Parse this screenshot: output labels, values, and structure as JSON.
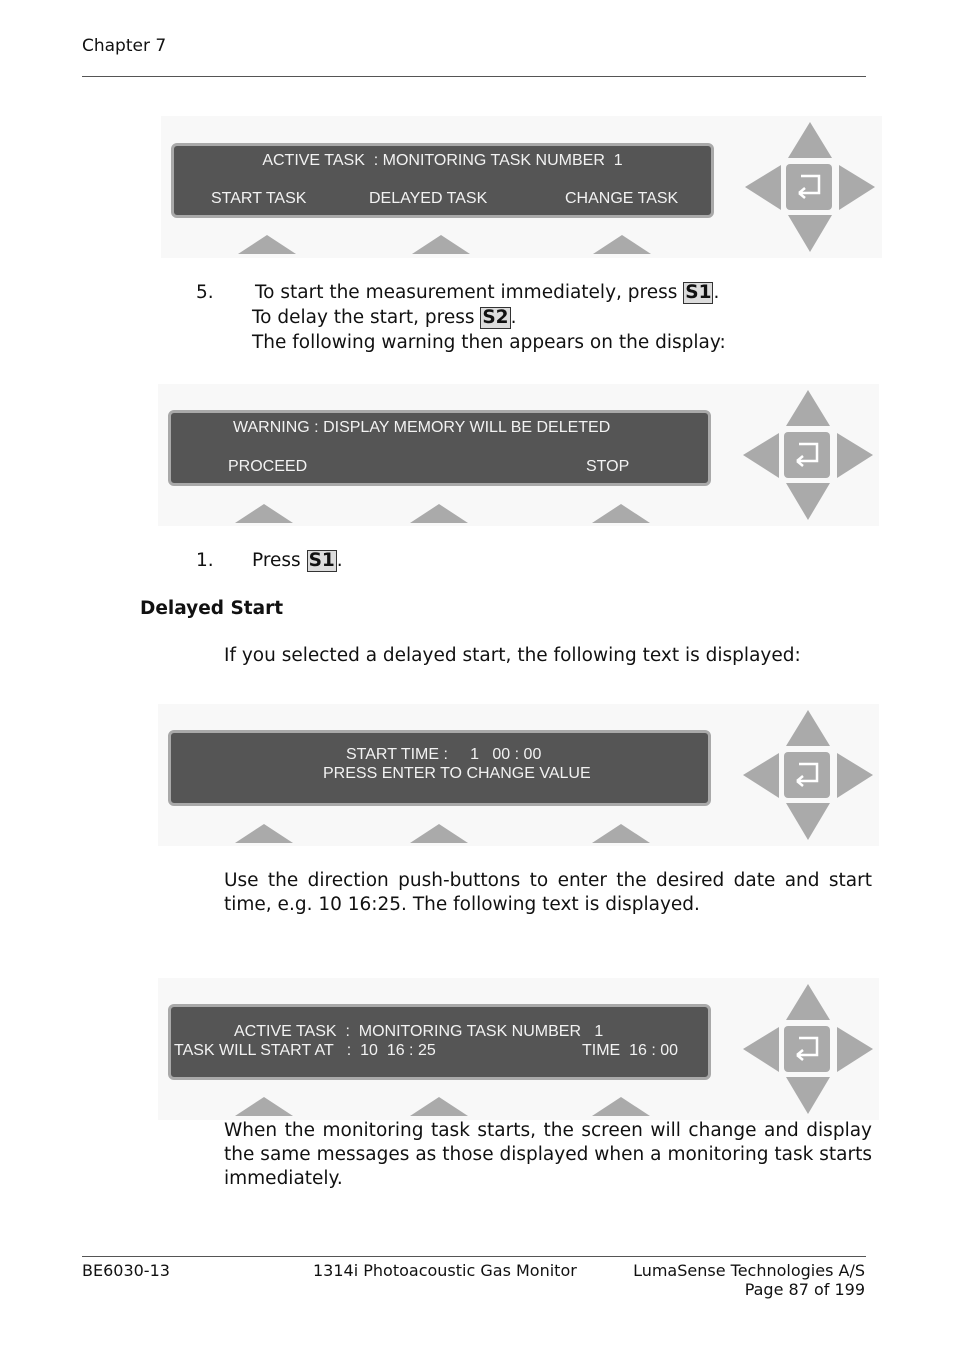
{
  "header": {
    "chapter": "Chapter 7"
  },
  "displays": [
    {
      "line1": "ACTIVE TASK  : MONITORING TASK NUMBER  1",
      "softkeys": [
        "START TASK",
        "DELAYED TASK",
        "CHANGE TASK"
      ]
    },
    {
      "line1": "WARNING : DISPLAY MEMORY WILL BE DELETED",
      "softkeys": [
        "PROCEED",
        "",
        "STOP"
      ]
    },
    {
      "line1": "START TIME :     1   00 : 00",
      "line2": "PRESS ENTER TO CHANGE VALUE"
    },
    {
      "line1": "ACTIVE TASK  :  MONITORING TASK NUMBER   1",
      "line2_left": "TASK WILL START AT   :  10  16 : 25",
      "line2_right": "TIME  16 : 00"
    }
  ],
  "step5": {
    "number": "5.",
    "line1_pre": "To start the measurement immediately, press ",
    "line1_key": "S1",
    "line2_pre": "To delay the start, press ",
    "line2_key": "S2",
    "line3": "The following warning then appears on the display:"
  },
  "step1": {
    "number": "1.",
    "pre": "Press ",
    "key": "S1"
  },
  "section": {
    "title": "Delayed Start"
  },
  "paragraphs": {
    "p1": "If you selected a delayed start, the following text is displayed:",
    "p2": "Use the direction push-buttons to enter the desired date and start time, e.g. 10 16:25. The following text is displayed.",
    "p3": "When the monitoring task starts, the screen will change and display the same messages as those displayed when a monitoring task starts immediately."
  },
  "footer": {
    "doc_id": "BE6030-13",
    "product": "1314i Photoacoustic Gas Monitor",
    "company": "LumaSense Technologies A/S",
    "page": "Page 87 of 199"
  },
  "colors": {
    "lcd_bg": "#555555",
    "lcd_border": "#a9a9a9",
    "button": "#aaaaaa",
    "panel": "#f8f8f8"
  }
}
